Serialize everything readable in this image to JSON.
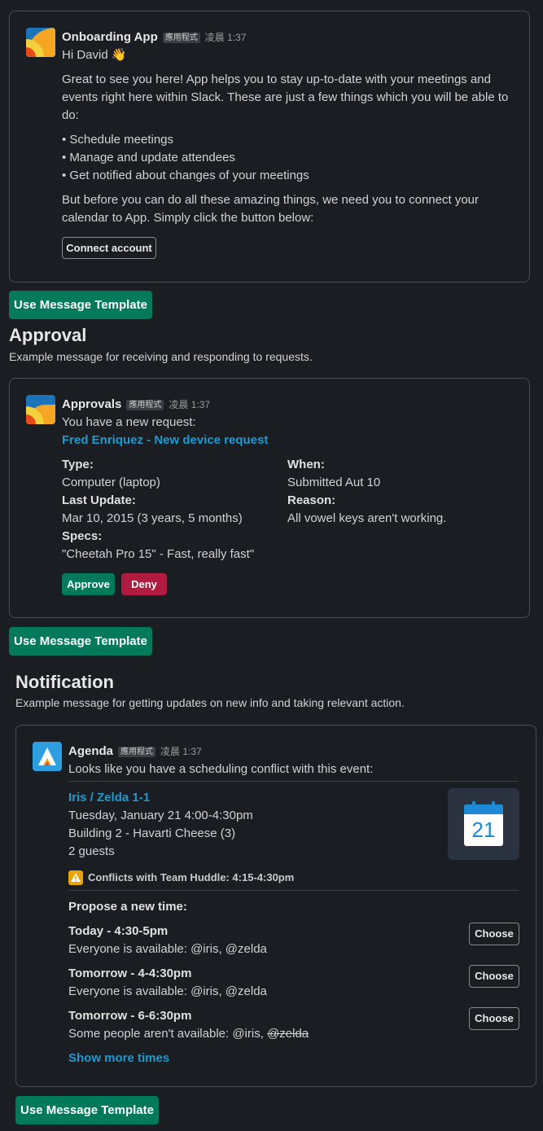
{
  "onboarding": {
    "app_name": "Onboarding App",
    "app_tag": "應用程式",
    "time": "凌晨 1:37",
    "greeting": "Hi David 👋",
    "intro_line1": "Great to see you here! App helps you to stay up-to-date with your meetings and",
    "intro_line2": "events right here within Slack. These are just a few things which you will be able to",
    "intro_line3": "do:",
    "bullets": [
      "• Schedule meetings",
      "• Manage and update attendees",
      "• Get notified about changes of your meetings"
    ],
    "outro_line1": "But before you can do all these amazing things, we need you to connect your",
    "outro_line2": "calendar to App. Simply click the button below:",
    "connect_button": "Connect account",
    "template_button": "Use Message Template"
  },
  "approval_section": {
    "title": "Approval",
    "description": "Example message for receiving and responding to requests."
  },
  "approval": {
    "app_name": "Approvals",
    "app_tag": "應用程式",
    "time": "凌晨 1:37",
    "intro": "You have a new request:",
    "request_link": "Fred Enriquez - New device request",
    "type_label": "Type:",
    "type_value": "Computer (laptop)",
    "when_label": "When:",
    "when_value": "Submitted Aut 10",
    "last_update_label": "Last Update:",
    "last_update_value": "Mar 10, 2015 (3 years, 5 months)",
    "reason_label": "Reason:",
    "reason_value": "All vowel keys aren't working.",
    "specs_label": "Specs:",
    "specs_value": "\"Cheetah Pro 15\" - Fast, really fast\"",
    "approve_button": "Approve",
    "deny_button": "Deny",
    "template_button": "Use Message Template"
  },
  "notification_section": {
    "title": "Notification",
    "description": "Example message for getting updates on new info and taking relevant action."
  },
  "agenda": {
    "app_name": "Agenda",
    "app_tag": "應用程式",
    "time": "凌晨 1:37",
    "intro": "Looks like you have a scheduling conflict with this event:",
    "event_title": "Iris / Zelda 1-1",
    "event_date": "Tuesday, January 21 4:00-4:30pm",
    "event_location": "Building 2 - Havarti Cheese (3)",
    "event_guests": "2 guests",
    "calendar_day": "21",
    "conflict_text": "Conflicts with Team Huddle: 4:15-4:30pm",
    "propose_label": "Propose a new time:",
    "options": [
      {
        "time": "Today - 4:30-5pm",
        "availability": "Everyone is available: @iris, @zelda",
        "button": "Choose"
      },
      {
        "time": "Tomorrow - 4-4:30pm",
        "availability": "Everyone is available: @iris, @zelda",
        "button": "Choose"
      },
      {
        "time": "Tomorrow - 6-6:30pm",
        "availability_prefix": "Some people aren't available: @iris, ",
        "availability_strike": "@zelda",
        "button": "Choose"
      }
    ],
    "show_more": "Show more times",
    "template_button": "Use Message Template"
  },
  "colors": {
    "background": "#1a1d21",
    "green": "#007a5a",
    "red": "#b01b3f",
    "link": "#1d9bd1",
    "warning": "#e8a400"
  }
}
